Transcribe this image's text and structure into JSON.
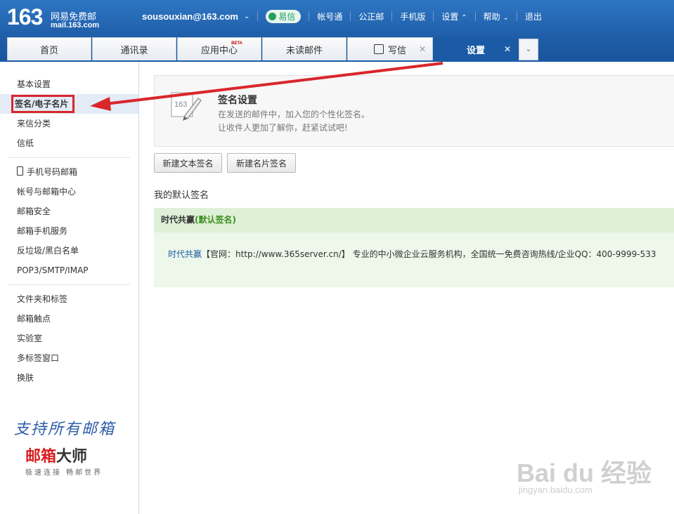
{
  "header": {
    "logo_number": "163",
    "logo_name": "网易免费邮",
    "logo_url": "mail.163.com",
    "user_email": "sousouxian@163.com",
    "nav": {
      "yixin": "易信",
      "account": "帐号通",
      "public_mail": "公正邮",
      "mobile": "手机版",
      "settings": "设置",
      "help": "帮助",
      "logout": "退出"
    }
  },
  "tabs": [
    {
      "label": "首页"
    },
    {
      "label": "通讯录"
    },
    {
      "label": "应用中心",
      "badge": "BETA"
    },
    {
      "label": "未读邮件"
    },
    {
      "label": "写信"
    },
    {
      "label": "设置"
    }
  ],
  "sidebar": {
    "group1": [
      "基本设置",
      "签名/电子名片",
      "来信分类",
      "信纸"
    ],
    "group2": [
      "手机号码邮箱",
      "帐号与邮箱中心",
      "邮箱安全",
      "邮箱手机服务",
      "反垃圾/黑白名单",
      "POP3/SMTP/IMAP"
    ],
    "group3": [
      "文件夹和标签",
      "邮箱触点",
      "实验室",
      "多标签窗口",
      "换肤"
    ],
    "promo_slogan": "支持所有邮箱",
    "promo_brand_red": "邮箱",
    "promo_brand_black": "大师",
    "promo_sub": "极速连接  畅邮世界"
  },
  "main": {
    "panel_title": "签名设置",
    "panel_desc1": "在发送的邮件中，加入您的个性化签名。",
    "panel_desc2": "让收件人更加了解你，赶紧试试吧!",
    "btn_new_text": "新建文本签名",
    "btn_new_card": "新建名片签名",
    "default_label": "我的默认签名",
    "signature_name": "时代共赢",
    "signature_default_tag": "(默认签名)",
    "signature_brand": "时代共赢",
    "signature_text": "【官网：http://www.365server.cn/】 专业的中小微企业云服务机构，全国统一免费咨询热线/企业QQ：400-9999-533"
  },
  "watermark": {
    "main": "Bai du 经验",
    "sub": "jingyan.baidu.com"
  },
  "colors": {
    "header_blue": "#1f5ea8",
    "highlight_red": "#d9262b",
    "sig_green_bg": "#edf7ea",
    "default_tag_green": "#3a8f1c"
  }
}
